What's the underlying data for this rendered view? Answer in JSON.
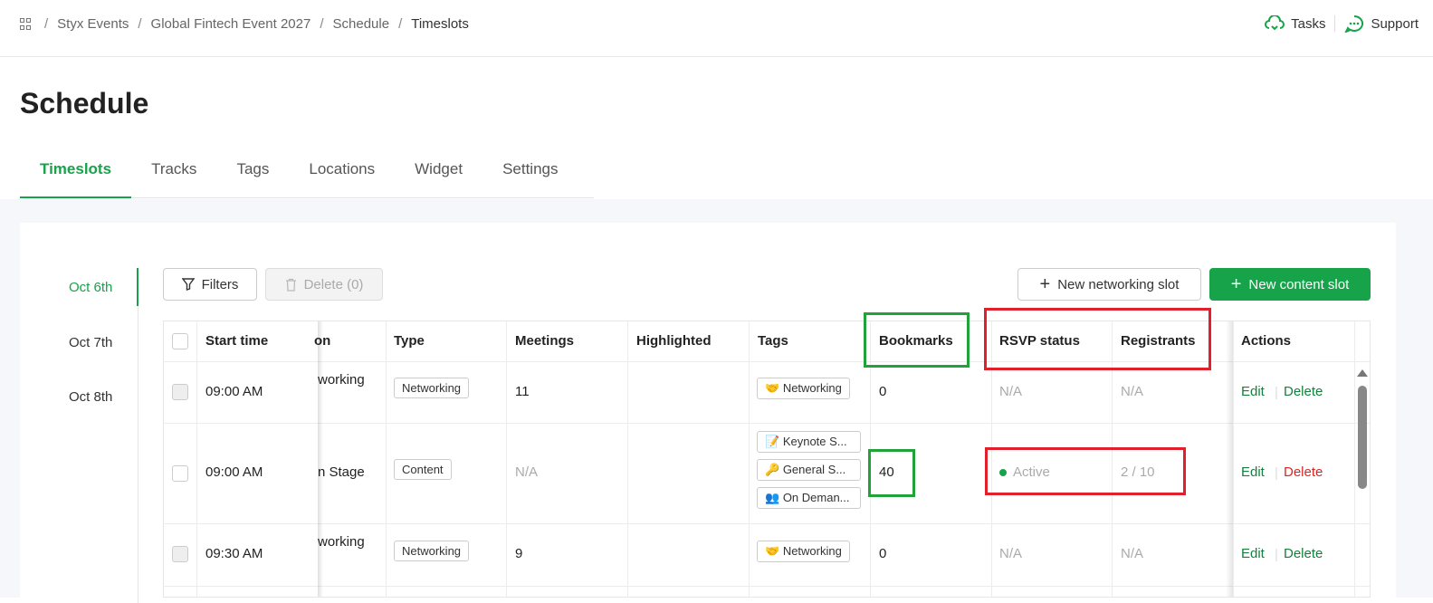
{
  "breadcrumb": {
    "items": [
      "Styx Events",
      "Global Fintech Event 2027",
      "Schedule",
      "Timeslots"
    ]
  },
  "header": {
    "tasks_label": "Tasks",
    "support_label": "Support"
  },
  "page": {
    "title": "Schedule"
  },
  "tabs": [
    {
      "label": "Timeslots",
      "active": true
    },
    {
      "label": "Tracks"
    },
    {
      "label": "Tags"
    },
    {
      "label": "Locations"
    },
    {
      "label": "Widget"
    },
    {
      "label": "Settings"
    }
  ],
  "dates": [
    {
      "label": "Oct 6th",
      "active": true
    },
    {
      "label": "Oct 7th"
    },
    {
      "label": "Oct 8th"
    }
  ],
  "toolbar": {
    "filters_label": "Filters",
    "delete_label": "Delete (0)",
    "new_networking_label": "New networking slot",
    "new_content_label": "New content slot"
  },
  "table": {
    "columns": [
      "Start time",
      "on",
      "Type",
      "Meetings",
      "Highlighted",
      "Tags",
      "Bookmarks",
      "RSVP status",
      "Registrants",
      "Actions"
    ],
    "rows": [
      {
        "start": "09:00 AM",
        "name": "working",
        "type": "Networking",
        "meetings": "11",
        "tags": [
          "Networking"
        ],
        "bookmarks": "0",
        "rsvp": "N/A",
        "registrants": "N/A",
        "edit": "Edit",
        "delete": "Delete"
      },
      {
        "start": "09:00 AM",
        "name": "n Stage",
        "type": "Content",
        "meetings": "N/A",
        "tags": [
          "Keynote S...",
          "General S...",
          "On Deman..."
        ],
        "bookmarks": "40",
        "rsvp": "Active",
        "registrants": "2 / 10",
        "edit": "Edit",
        "delete": "Delete"
      },
      {
        "start": "09:30 AM",
        "name": "working",
        "type": "Networking",
        "meetings": "9",
        "tags": [
          "Networking"
        ],
        "bookmarks": "0",
        "rsvp": "N/A",
        "registrants": "N/A",
        "edit": "Edit",
        "delete": "Delete"
      }
    ]
  },
  "colors": {
    "accent": "#16a34a",
    "danger": "#dc2626",
    "highlight_green": "#22a33a",
    "highlight_red": "#e0202a"
  }
}
